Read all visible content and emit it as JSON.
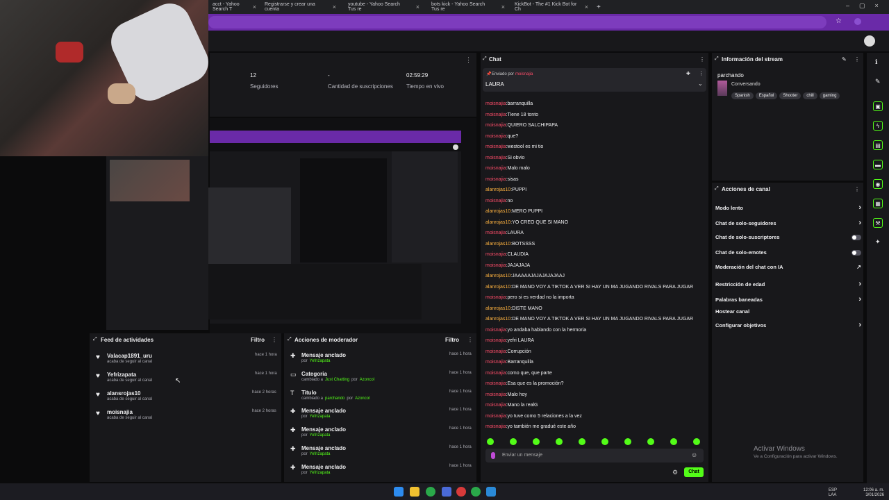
{
  "browser": {
    "tabs": [
      {
        "label": "acct - Yahoo Search T"
      },
      {
        "label": "Registrarse y crear una cuenta"
      },
      {
        "label": "youtube - Yahoo Search Tus re"
      },
      {
        "label": "bots kick - Yahoo Search Tus re"
      },
      {
        "label": "KickBot - The #1 Kick Bot for Ch"
      }
    ],
    "new_tab": "+"
  },
  "stats": [
    {
      "value": "12",
      "label": "Seguidores"
    },
    {
      "value": "-",
      "label": "Cantidad de suscripciones"
    },
    {
      "value": "02:59:29",
      "label": "Tiempo en vivo"
    }
  ],
  "activity_feed": {
    "title": "Feed de actividades",
    "filter": "Filtro",
    "items": [
      {
        "name": "Valacap1891_uru",
        "desc": "acaba de seguir al canal",
        "time": "hace 1 hora"
      },
      {
        "name": "Yefrizapata",
        "desc": "acaba de seguir al canal",
        "time": "hace 1 hora"
      },
      {
        "name": "alansrojas10",
        "desc": "acaba de seguir al canal",
        "time": "hace 2 horas"
      },
      {
        "name": "moisnajia",
        "desc": "acaba de seguir al canal",
        "time": "hace 2 horas"
      }
    ]
  },
  "mod_actions": {
    "title": "Acciones de moderador",
    "filter": "Filtro",
    "items": [
      {
        "icon": "pin-icon",
        "title": "Mensaje anclado",
        "prefix": "por",
        "user": "Yefrizapata",
        "time": "hace 1 hora"
      },
      {
        "icon": "category-icon",
        "title": "Categoria",
        "prefix": "cambiado a",
        "user": "Just Chatting",
        "by": "por",
        "user2": "Azoncol",
        "time": "hace 1 hora"
      },
      {
        "icon": "title-icon",
        "title": "Titulo",
        "prefix": "cambiado a",
        "user": "parchando",
        "by": "por",
        "user2": "Azoncol",
        "time": "hace 1 hora"
      },
      {
        "icon": "pin-icon",
        "title": "Mensaje anclado",
        "prefix": "por",
        "user": "Yefrizapata",
        "time": "hace 1 hora"
      },
      {
        "icon": "pin-icon",
        "title": "Mensaje anclado",
        "prefix": "por",
        "user": "Yefrizapata",
        "time": "hace 1 hora"
      },
      {
        "icon": "pin-icon",
        "title": "Mensaje anclado",
        "prefix": "por",
        "user": "Yefrizapata",
        "time": "hace 1 hora"
      },
      {
        "icon": "pin-icon",
        "title": "Mensaje anclado",
        "prefix": "por",
        "user": "Yefrizapata",
        "time": "hace 1 hora"
      }
    ]
  },
  "chat": {
    "title": "Chat",
    "pinned_label": "Enviado por",
    "pinned_user": "moisnajia",
    "pinned_message": "LAURA",
    "messages": [
      {
        "user": "moisnajia",
        "text": "barranquilla",
        "color": "red"
      },
      {
        "user": "moisnajia",
        "text": "Tiene 18 tonto",
        "color": "red"
      },
      {
        "user": "moisnajia",
        "text": "QUIERO SALCHIPAPA",
        "color": "red"
      },
      {
        "user": "moisnajia",
        "text": "que?",
        "color": "red"
      },
      {
        "user": "moisnajia",
        "text": "westool es mi tio",
        "color": "red"
      },
      {
        "user": "moisnajia",
        "text": "Si obvio",
        "color": "red"
      },
      {
        "user": "moisnajia",
        "text": "Malo malo",
        "color": "red"
      },
      {
        "user": "moisnajia",
        "text": "sisas",
        "color": "red"
      },
      {
        "user": "alanrojas10",
        "text": "PUPPI",
        "color": "orange"
      },
      {
        "user": "moisnajia",
        "text": "no",
        "color": "red"
      },
      {
        "user": "alanrojas10",
        "text": "MERO PUPPI",
        "color": "orange"
      },
      {
        "user": "alanrojas10",
        "text": "YO CREO QUE SI MANO",
        "color": "orange"
      },
      {
        "user": "moisnajia",
        "text": "LAURA",
        "color": "red"
      },
      {
        "user": "alanrojas10",
        "text": "BOTSSSS",
        "color": "orange"
      },
      {
        "user": "moisnajia",
        "text": "CLAUDIA",
        "color": "red"
      },
      {
        "user": "moisnajia",
        "text": "JAJAJAJA",
        "color": "red"
      },
      {
        "user": "alanrojas10",
        "text": "JAAAAAJAJAJAJAJAAJ",
        "color": "orange"
      },
      {
        "user": "alanrojas10",
        "text": "DE MANO VOY A TIKTOK A VER SI HAY UN MA JUGANDO RIVALS PARA JUGAR",
        "color": "orange"
      },
      {
        "user": "moisnajia",
        "text": "pero si es verdad no la importa",
        "color": "red"
      },
      {
        "user": "alanrojas10",
        "text": "DISTE MANO",
        "color": "orange"
      },
      {
        "user": "alanrojas10",
        "text": "DE MANO VOY A TIKTOK A VER SI HAY UN MA JUGANDO RIVALS PARA JUGAR",
        "color": "orange"
      },
      {
        "user": "moisnajia",
        "text": "yo andaba hablando con la hermoria",
        "color": "red"
      },
      {
        "user": "moisnajia",
        "text": "yefri LAURA",
        "color": "red"
      },
      {
        "user": "moisnajia",
        "text": "Corrupción",
        "color": "red"
      },
      {
        "user": "moisnajia",
        "text": "Barranquilla",
        "color": "red"
      },
      {
        "user": "moisnajia",
        "text": "como que, que parte",
        "color": "red"
      },
      {
        "user": "moisnajia",
        "text": "Esa que es la promoción?",
        "color": "red"
      },
      {
        "user": "moisnajia",
        "text": "Malo hoy",
        "color": "red"
      },
      {
        "user": "moisnajia",
        "text": "Mano la realG",
        "color": "red"
      },
      {
        "user": "moisnajia",
        "text": "yo tuve como 5 relaciones a la vez",
        "color": "red"
      },
      {
        "user": "moisnajia",
        "text": "yo también me gradué este año",
        "color": "red"
      }
    ],
    "input_placeholder": "Enviar un mensaje",
    "send_label": "Chat"
  },
  "stream_info": {
    "title": "Información del stream",
    "stream_title": "parchando",
    "category": "Conversando",
    "tags": [
      "Spanish",
      "Español",
      "Shooter",
      "chill",
      "gaming"
    ]
  },
  "channel_actions": {
    "title": "Acciones de canal",
    "items": [
      {
        "label": "Modo lento",
        "control": "chevron"
      },
      {
        "label": "Chat de solo-seguidores",
        "control": "chevron"
      },
      {
        "label": "Chat de solo-suscriptores",
        "control": "toggle"
      },
      {
        "label": "Chat de solo-emotes",
        "control": "toggle"
      },
      {
        "label": "Moderación del chat con IA",
        "control": "external"
      },
      {
        "label": "Restricción de edad",
        "control": "chevron"
      },
      {
        "label": "Palabras baneadas",
        "control": "chevron"
      },
      {
        "label": "Hostear canal",
        "control": "none"
      },
      {
        "label": "Configurar objetivos",
        "control": "chevron"
      }
    ]
  },
  "watermark": {
    "title": "Activar Windows",
    "subtitle": "Ve a Configuración para activar Windows."
  },
  "taskbar": {
    "lang": "ESP",
    "region": "LAA",
    "time": "12:06 a. m.",
    "date": "3/01/2026"
  },
  "colors": {
    "accent": "#53fc18",
    "chrome": "#6a2aa8",
    "username_red": "#ff4d6a",
    "username_orange": "#ffb340"
  }
}
